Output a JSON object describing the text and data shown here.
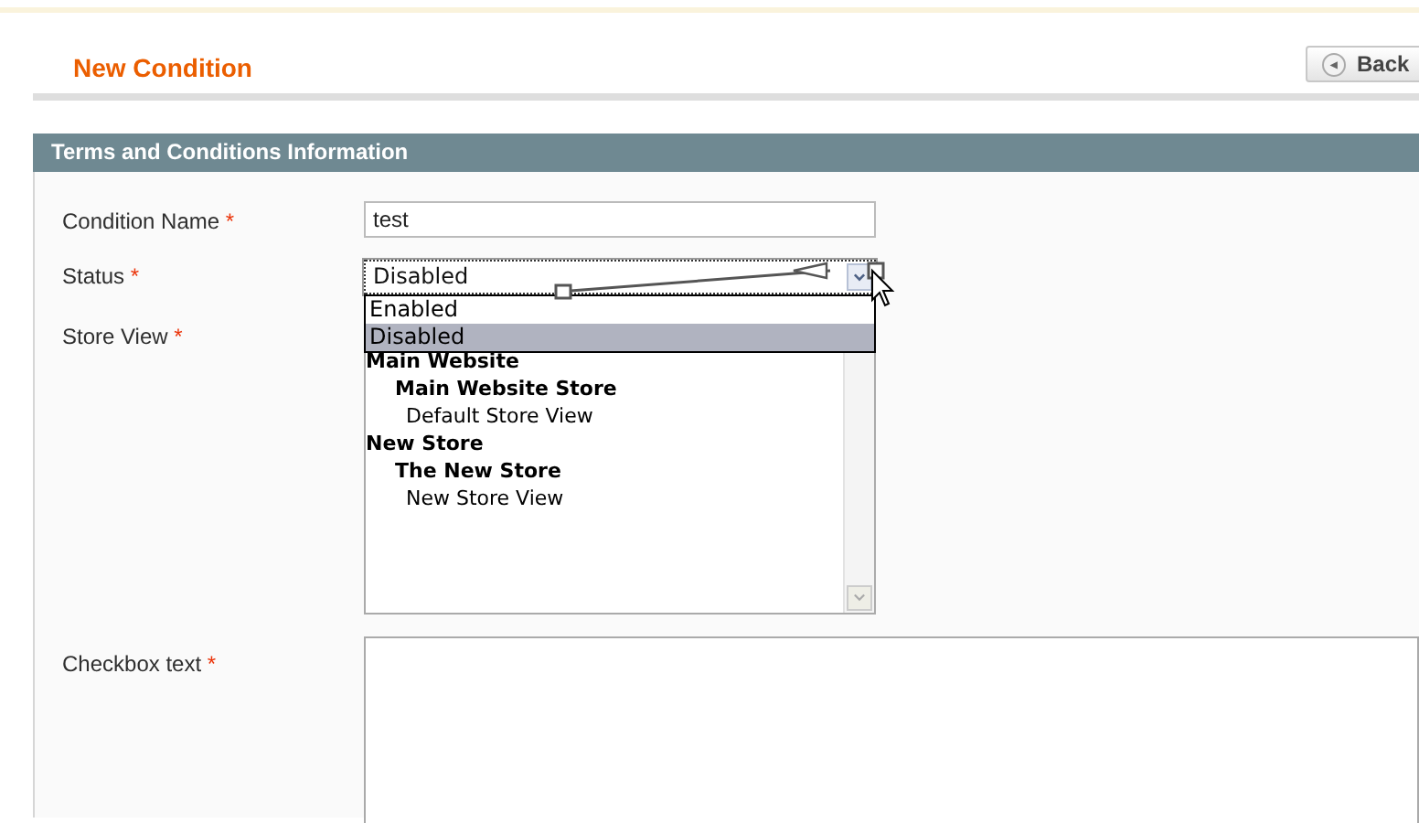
{
  "page": {
    "title": "New Condition",
    "back_button": {
      "label": "Back",
      "icon": "◀"
    }
  },
  "section": {
    "title": "Terms and Conditions Information"
  },
  "fields": [
    {
      "kind": "text",
      "label": "Condition Name",
      "required_mark": "*",
      "value": "test"
    },
    {
      "kind": "select",
      "label": "Status",
      "required_mark": "*",
      "value": "Disabled",
      "expanded": true,
      "options": [
        {
          "label": "Enabled",
          "selected": false
        },
        {
          "label": "Disabled",
          "selected": true
        }
      ]
    },
    {
      "kind": "multiselect",
      "label": "Store View",
      "required_mark": "*",
      "items": [
        {
          "label": "Main Website",
          "children": [
            {
              "label": "Main Website Store",
              "children": [
                {
                  "label": "Default Store View"
                }
              ]
            }
          ]
        },
        {
          "label": "New Store",
          "children": [
            {
              "label": "The New Store",
              "children": [
                {
                  "label": "New Store View"
                }
              ]
            }
          ]
        }
      ]
    },
    {
      "kind": "textarea",
      "label": "Checkbox text",
      "required_mark": "*"
    }
  ]
}
